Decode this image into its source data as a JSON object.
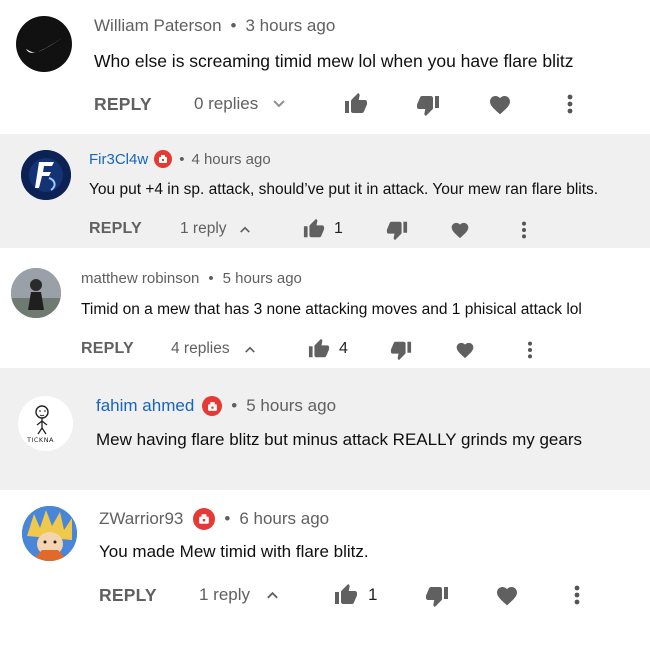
{
  "comments": [
    {
      "author": "William Paterson",
      "time": "3 hours ago",
      "text": "Who else is screaming timid mew lol when you have flare blitz",
      "reply_label": "REPLY",
      "replies_label": "0 replies",
      "replies_toggle": "chevron-down",
      "likes": "",
      "highlighted": false,
      "badge": false
    },
    {
      "author": "Fir3Cl4w",
      "time": "4 hours ago",
      "text": "You put +4 in sp. attack, should’ve put it in attack. Your mew ran flare blits.",
      "reply_label": "REPLY",
      "replies_label": "1 reply",
      "replies_toggle": "chevron-up",
      "likes": "1",
      "highlighted": true,
      "badge": true
    },
    {
      "author": "matthew robinson",
      "time": "5 hours ago",
      "text": "Timid on a mew that has 3 none attacking moves and 1 phisical attack lol",
      "reply_label": "REPLY",
      "replies_label": "4 replies",
      "replies_toggle": "chevron-up",
      "likes": "4",
      "highlighted": false,
      "badge": false
    },
    {
      "author": "fahim ahmed",
      "time": "5 hours ago",
      "text": "Mew having flare blitz but minus attack REALLY grinds my gears",
      "highlighted": true,
      "badge": true
    },
    {
      "author": "ZWarrior93",
      "time": "6 hours ago",
      "text": "You made Mew timid with flare blitz.",
      "reply_label": "REPLY",
      "replies_label": "1 reply",
      "replies_toggle": "chevron-up",
      "likes": "1",
      "highlighted": false,
      "badge": true
    }
  ],
  "separator": "•",
  "avatar_text": {
    "fahim": "TICKNA"
  },
  "colors": {
    "highlight_bg": "#f0f0f0",
    "link_blue": "#1565c0",
    "badge_red": "#e53935",
    "icon_gray": "#606060"
  }
}
